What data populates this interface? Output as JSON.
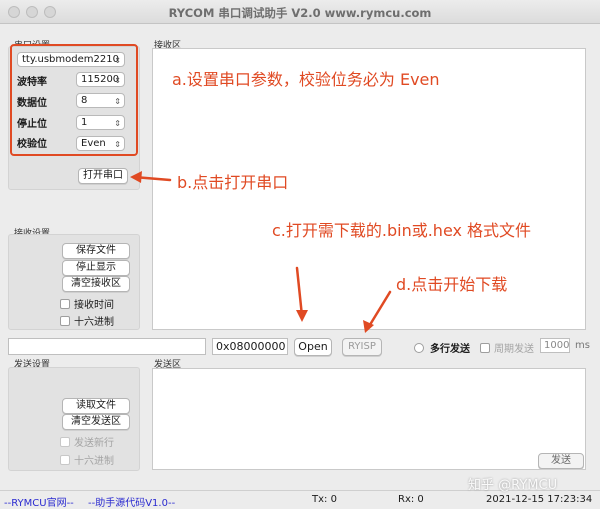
{
  "window": {
    "title": "RYCOM 串口调试助手 V2.0 www.rymcu.com"
  },
  "serial_settings": {
    "section_label": "串口设置",
    "port": "tty.usbmodem2210",
    "baud_label": "波特率",
    "baud": "115200",
    "databits_label": "数据位",
    "databits": "8",
    "stopbits_label": "停止位",
    "stopbits": "1",
    "parity_label": "校验位",
    "parity": "Even",
    "open_button": "打开串口"
  },
  "receive_settings": {
    "section_label": "接收设置",
    "save_file": "保存文件",
    "stop_display": "停止显示",
    "clear_receive": "清空接收区",
    "receive_time": "接收时间",
    "hex_mode": "十六进制"
  },
  "receive_area": {
    "label": "接收区"
  },
  "download_bar": {
    "file_path": "",
    "address": "0x08000000",
    "open_button": "Open",
    "isp_button": "RYISP",
    "multi_send": "多行发送",
    "periodic_send": "周期发送",
    "period_value": "1000",
    "period_unit": "ms"
  },
  "send_settings": {
    "section_label": "发送设置",
    "read_file": "读取文件",
    "clear_send": "清空发送区",
    "send_newline": "发送新行",
    "hex_mode": "十六进制"
  },
  "send_area": {
    "label": "发送区",
    "send_button": "发送"
  },
  "status_bar": {
    "official_site": "--RYMCU官网--",
    "source_code": "--助手源代码V1.0--",
    "tx": "Tx: 0",
    "rx": "Rx: 0",
    "datetime": "2021-12-15 17:23:34"
  },
  "annotations": {
    "a": "a.设置串口参数，校验位务必为 Even",
    "b": "b.点击打开串口",
    "c": "c.打开需下载的.bin或.hex 格式文件",
    "d": "d.点击开始下载",
    "color": "#e04a23"
  },
  "watermark": "知乎 @RYMCU"
}
